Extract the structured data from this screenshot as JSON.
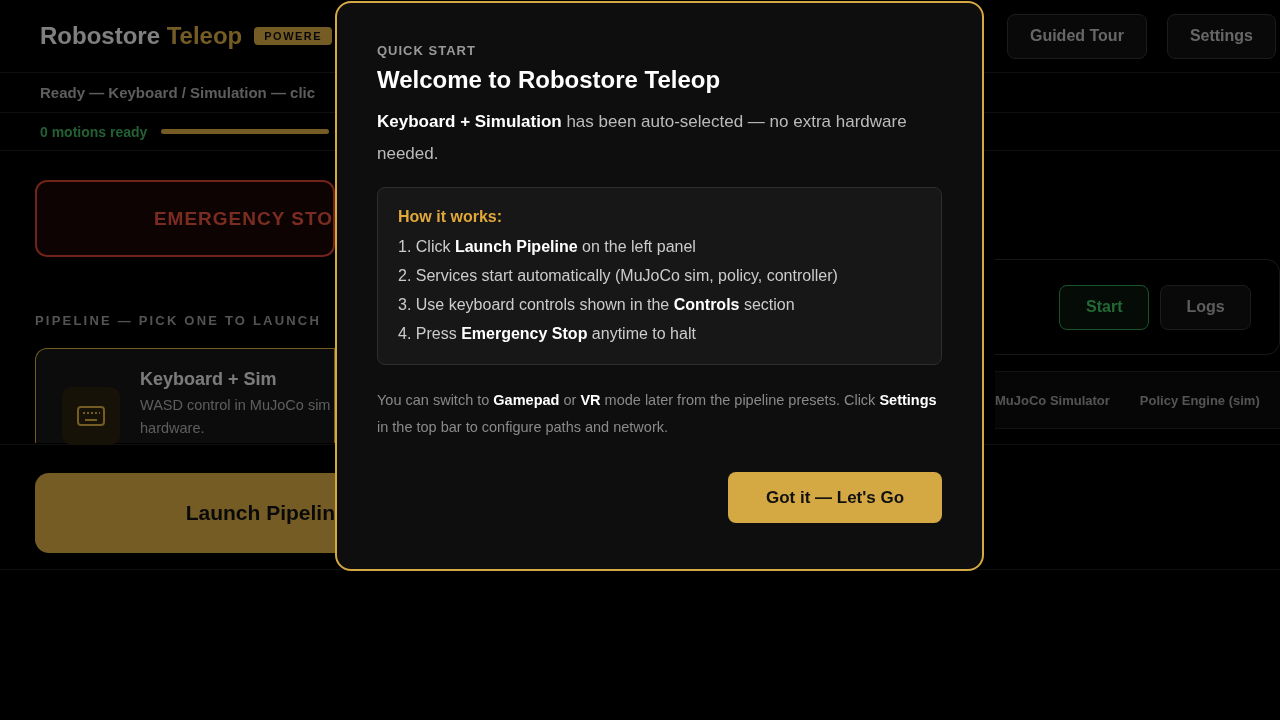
{
  "header": {
    "title": "Robostore",
    "title_accent": "Teleop",
    "badge": "POWERE",
    "buttons": [
      "Guided Tour",
      "Settings"
    ]
  },
  "status": "Ready — Keyboard / Simulation — clic",
  "motions": {
    "label": "0 motions ready"
  },
  "emergency_stop": "EMERGENCY STO",
  "pipeline": {
    "heading": "PIPELINE — PICK ONE TO LAUNCH",
    "presets": [
      {
        "title": "Keyboard + Sim",
        "description_lines": [
          "WASD control in MuJoCo sim",
          "hardware."
        ],
        "selected": true
      }
    ]
  },
  "service_card": {
    "buttons": [
      {
        "label": "Start",
        "kind": "start"
      },
      {
        "label": "Logs",
        "kind": "plain"
      }
    ]
  },
  "services": [
    "MuJoCo Simulator",
    "Policy Engine (sim)"
  ],
  "launch_button": "Launch Pipelin",
  "modal": {
    "eyebrow": "QUICK START",
    "title": "Welcome to Robostore Teleop",
    "intro": "**Keyboard + Simulation** has been auto-selected — no extra hardware needed.",
    "how_title": "How it works:",
    "steps": [
      "1. Click **Launch Pipeline** on the left panel",
      "2. Services start automatically (MuJoCo sim, policy, controller)",
      "3. Use keyboard controls shown in the **Controls** section",
      "4. Press **Emergency Stop** anytime to halt"
    ],
    "note": "You can switch to **Gamepad** or **VR** mode later from the pipeline presets. Click **Settings** in the top bar to configure paths and network.",
    "button": "Got it — Let's Go"
  }
}
